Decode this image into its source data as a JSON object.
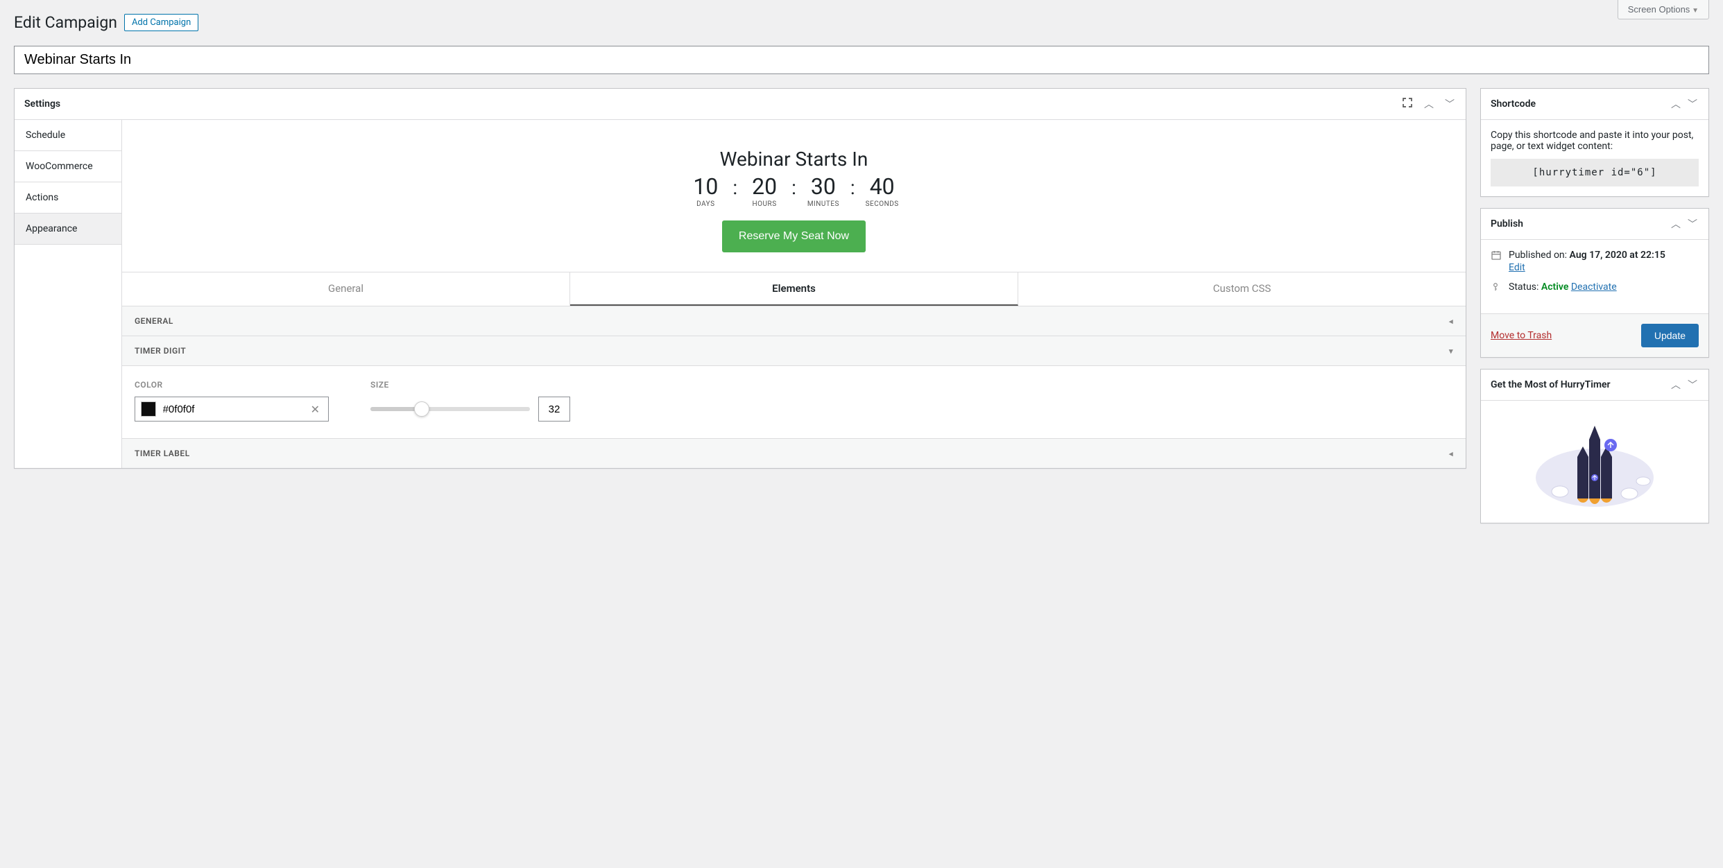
{
  "screen_options_label": "Screen Options",
  "page_title": "Edit Campaign",
  "add_campaign_label": "Add Campaign",
  "title_value": "Webinar Starts In",
  "settings": {
    "header": "Settings",
    "tabs": {
      "schedule": "Schedule",
      "woocommerce": "WooCommerce",
      "actions": "Actions",
      "appearance": "Appearance"
    },
    "preview": {
      "title": "Webinar Starts In",
      "days": "10",
      "days_label": "DAYS",
      "hours": "20",
      "hours_label": "HOURS",
      "minutes": "30",
      "minutes_label": "MINUTES",
      "seconds": "40",
      "seconds_label": "SECONDS",
      "separator": ":",
      "cta_label": "Reserve My Seat Now"
    },
    "appearance_tabs": {
      "general": "General",
      "elements": "Elements",
      "custom_css": "Custom CSS"
    },
    "sections": {
      "general": "GENERAL",
      "timer_digit": "TIMER DIGIT",
      "timer_label": "TIMER LABEL"
    },
    "fields": {
      "color_label": "COLOR",
      "color_value": "#0f0f0f",
      "size_label": "SIZE",
      "size_value": "32"
    }
  },
  "shortcode": {
    "header": "Shortcode",
    "instructions": "Copy this shortcode and paste it into your post, page, or text widget content:",
    "code": "[hurrytimer id=\"6\"]"
  },
  "publish": {
    "header": "Publish",
    "published_on_label": "Published on:",
    "published_on_value": "Aug 17, 2020 at 22:15",
    "edit_label": "Edit",
    "status_label": "Status:",
    "status_value": "Active",
    "deactivate_label": "Deactivate",
    "trash_label": "Move to Trash",
    "update_label": "Update"
  },
  "promo": {
    "header": "Get the Most of HurryTimer"
  }
}
